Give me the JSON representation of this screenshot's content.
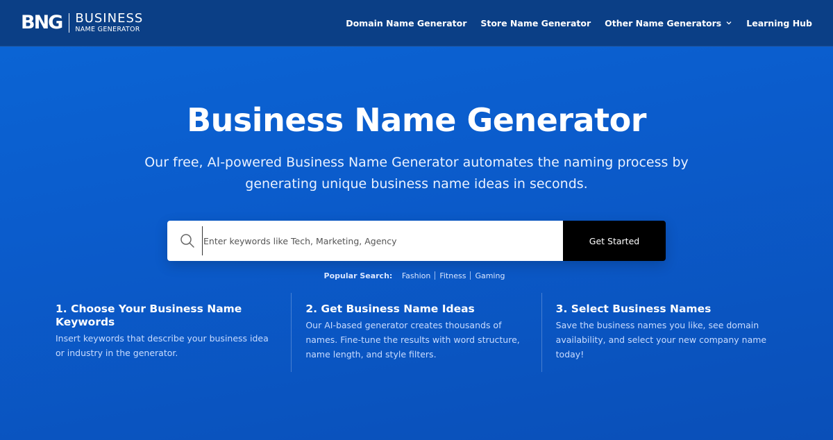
{
  "header": {
    "logo_mark": "BNG",
    "logo_line1": "BUSINESS",
    "logo_line2": "NAME GENERATOR",
    "nav": [
      {
        "label": "Domain Name Generator"
      },
      {
        "label": "Store Name Generator"
      },
      {
        "label": "Other Name Generators"
      },
      {
        "label": "Learning Hub"
      }
    ]
  },
  "hero": {
    "title": "Business Name Generator",
    "subtitle": "Our free, AI-powered Business Name Generator automates the naming process by generating unique business name ideas in seconds."
  },
  "search": {
    "placeholder": "Enter keywords like Tech, Marketing, Agency",
    "button_label": "Get Started",
    "popular_label": "Popular Search:",
    "popular_items": [
      "Fashion",
      "Fitness",
      "Gaming"
    ]
  },
  "steps": [
    {
      "title": "1. Choose Your Business Name Keywords",
      "desc": "Insert keywords that describe your business idea or industry in the generator."
    },
    {
      "title": "2. Get Business Name Ideas",
      "desc": "Our AI-based generator creates thousands of names. Fine-tune the results with word structure, name length, and style filters."
    },
    {
      "title": "3. Select Business Names",
      "desc": "Save the business names you like, see domain availability, and select your new company name today!"
    }
  ],
  "colors": {
    "header_bg": "#0b3f86",
    "hero_bg": "#0b5ccc",
    "button_bg": "#000000"
  },
  "icons": {
    "search": "search-icon",
    "dropdown": "chevron-down-icon"
  }
}
